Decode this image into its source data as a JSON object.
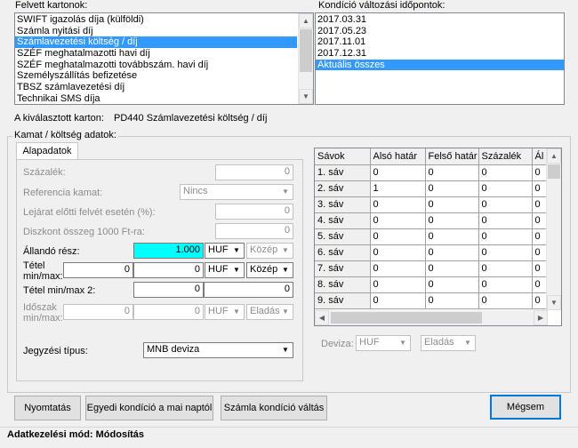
{
  "top": {
    "cards_label": "Felvett kartonok:",
    "cards": [
      "SWIFT igazolás díja (külföldi)",
      "Számla nyitási díj",
      "Számlavezetési költség / díj",
      "SZÉF meghatalmazotti havi díj",
      "SZÉF meghatalmazotti továbbszám. havi díj",
      "Személyszállítás befizetése",
      "TBSZ számlavezetési díj",
      "Technikai SMS díja"
    ],
    "cards_selected_index": 2,
    "dates_label": "Kondíció változási időpontok:",
    "dates": [
      "2017.03.31",
      "2017.05.23",
      "2017.11.01",
      "2017.12.31",
      "Aktuális összes"
    ],
    "dates_selected_index": 4
  },
  "selected": {
    "label": "A kiválasztott karton:",
    "value": "PD440 Számlavezetési költség / díj"
  },
  "group": {
    "title": "Kamat / költség adatok:",
    "tab": "Alapadatok"
  },
  "form": {
    "szazalek_label": "Százalék:",
    "szazalek_value": "0",
    "ref_label": "Referencia kamat:",
    "ref_value": "Nincs",
    "lejarat_label": "Lejárat előtti felvét esetén (%):",
    "lejarat_value": "0",
    "diszkont_label": "Diszkont összeg 1000 Ft-ra:",
    "diszkont_value": "0",
    "allando_label": "Állandó rész:",
    "allando_value": "1.000",
    "allando_currency": "HUF",
    "allando_rate": "Közép",
    "tetel_label_1": "Tétel",
    "tetel_label_2": "min/max:",
    "tetel_min": "0",
    "tetel_max": "0",
    "tetel_currency": "HUF",
    "tetel_rate": "Közép",
    "tetel2_label": "Tétel min/max 2:",
    "tetel2_min": "0",
    "tetel2_max": "0",
    "idoszak_label_1": "Időszak",
    "idoszak_label_2": "min/max:",
    "idoszak_min": "0",
    "idoszak_max": "0",
    "idoszak_currency": "HUF",
    "idoszak_rate": "Eladás",
    "jegyzesi_label": "Jegyzési típus:",
    "jegyzesi_value": "MNB deviza"
  },
  "grid": {
    "headers": [
      "Sávok",
      "Alsó határ",
      "Felső határ",
      "Százalék",
      "Ál"
    ],
    "rows": [
      [
        "1. sáv",
        "0",
        "0",
        "0",
        "0"
      ],
      [
        "2. sáv",
        "1",
        "0",
        "0",
        "0"
      ],
      [
        "3. sáv",
        "0",
        "0",
        "0",
        "0"
      ],
      [
        "4. sáv",
        "0",
        "0",
        "0",
        "0"
      ],
      [
        "5. sáv",
        "0",
        "0",
        "0",
        "0"
      ],
      [
        "6. sáv",
        "0",
        "0",
        "0",
        "0"
      ],
      [
        "7. sáv",
        "0",
        "0",
        "0",
        "0"
      ],
      [
        "8. sáv",
        "0",
        "0",
        "0",
        "0"
      ],
      [
        "9. sáv",
        "0",
        "0",
        "0",
        "0"
      ]
    ],
    "deviza_label": "Deviza:",
    "deviza_value": "HUF",
    "deviza_rate": "Eladás"
  },
  "buttons": {
    "print": "Nyomtatás",
    "custom": "Egyedi kondíció a mai naptól",
    "switch": "Számla kondíció váltás",
    "cancel": "Mégsem"
  },
  "status": "Adatkezelési mód: Módosítás"
}
